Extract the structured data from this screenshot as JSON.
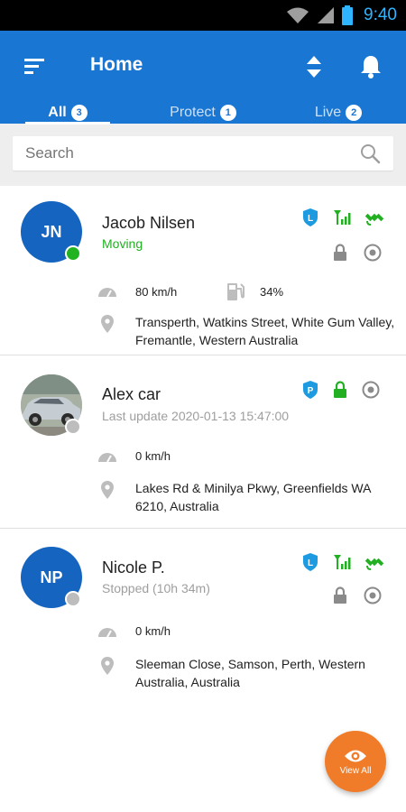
{
  "statusbar": {
    "time": "9:40"
  },
  "appbar": {
    "title": "Home"
  },
  "tabs": [
    {
      "label": "All",
      "count": "3"
    },
    {
      "label": "Protect",
      "count": "1"
    },
    {
      "label": "Live",
      "count": "2"
    }
  ],
  "search": {
    "placeholder": "Search"
  },
  "devices": [
    {
      "initials": "JN",
      "name": "Jacob Nilsen",
      "status": "Moving",
      "speed": "80 km/h",
      "fuel": "34%",
      "address": "Transperth, Watkins Street, White Gum Valley, Fremantle, Western Australia"
    },
    {
      "name": "Alex car",
      "status": "Last update 2020-01-13 15:47:00",
      "speed": "0 km/h",
      "address": "Lakes Rd & Minilya Pkwy, Greenfields WA 6210, Australia"
    },
    {
      "initials": "NP",
      "name": "Nicole P.",
      "status": "Stopped (10h 34m)",
      "speed": "0 km/h",
      "address": "Sleeman Close, Samson, Perth, Western Australia, Australia"
    }
  ],
  "fab": {
    "label": "View All"
  },
  "colors": {
    "primary": "#1976d2",
    "moving": "#22b022",
    "accent": "#f07c2a",
    "badge": "#1e9be0"
  }
}
